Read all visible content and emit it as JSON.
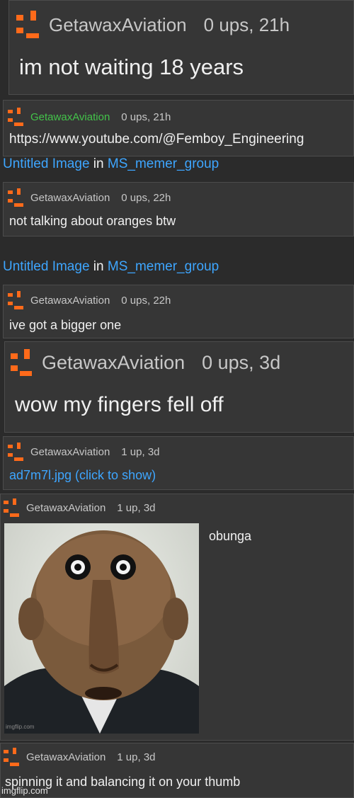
{
  "brand_color": "#ff6a1a",
  "link_color": "#3ea6ff",
  "comments": [
    {
      "user": "GetawaxAviation",
      "meta": "0 ups, 21h",
      "text": "im not waiting 18 years"
    },
    {
      "user": "GetawaxAviation",
      "meta": "0 ups, 21h",
      "text": "https://www.youtube.com/@Femboy_Engineering"
    },
    {
      "user": "GetawaxAviation",
      "meta": "0 ups, 22h",
      "text": "not talking about oranges btw"
    },
    {
      "user": "GetawaxAviation",
      "meta": "0 ups, 22h",
      "text": "ive got a bigger one"
    },
    {
      "user": "GetawaxAviation",
      "meta": "0 ups, 3d",
      "text": "wow my fingers fell off"
    },
    {
      "user": "GetawaxAviation",
      "meta": "1 up, 3d",
      "text": "ad7m7l.jpg (click to show)"
    },
    {
      "user": "GetawaxAviation",
      "meta": "1 up, 3d",
      "text": "obunga"
    },
    {
      "user": "GetawaxAviation",
      "meta": "1 up, 3d",
      "text": "spinning it and balancing it on your thumb"
    }
  ],
  "context_links": [
    {
      "title": "Untitled Image",
      "sep": "in",
      "group": "MS_memer_group"
    },
    {
      "title": "Untitled Image",
      "sep": "in",
      "group": "MS_memer_group"
    }
  ],
  "image_watermark": "imgflip.com",
  "footer_watermark": "imgflip.com"
}
